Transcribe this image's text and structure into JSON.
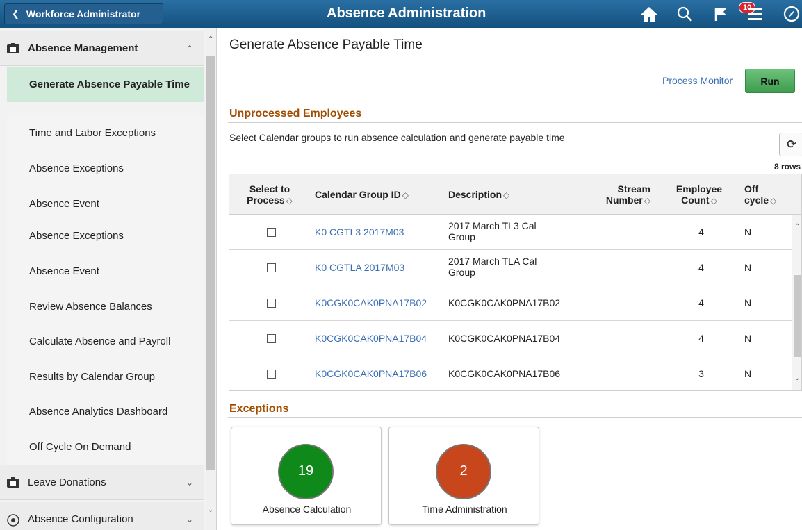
{
  "header": {
    "back_label": "Workforce Administrator",
    "title": "Absence Administration",
    "notification_count": "10",
    "icons": [
      "home-icon",
      "search-icon",
      "flag-icon",
      "menu-icon",
      "compass-icon"
    ]
  },
  "sidebar": {
    "groups": [
      {
        "label": "Absence Management",
        "icon": "folder-icon",
        "expanded": true
      },
      {
        "label": "Leave Donations",
        "icon": "folder-icon",
        "expanded": false
      },
      {
        "label": "Absence Configuration",
        "icon": "gear-icon",
        "expanded": false
      }
    ],
    "items": [
      {
        "label": "Generate Absence Payable Time",
        "active": true
      },
      {
        "label": "Time and Labor Exceptions"
      },
      {
        "label": "Absence Exceptions"
      },
      {
        "label": "Absence Event"
      },
      {
        "label": "Absence Exceptions"
      },
      {
        "label": "Absence Event"
      },
      {
        "label": "Review Absence Balances"
      },
      {
        "label": "Calculate Absence and Payroll"
      },
      {
        "label": "Results by Calendar Group"
      },
      {
        "label": "Absence Analytics Dashboard"
      },
      {
        "label": "Off Cycle On Demand"
      }
    ]
  },
  "main": {
    "page_title": "Generate Absence Payable Time",
    "process_monitor_label": "Process Monitor",
    "run_label": "Run",
    "unprocessed_title": "Unprocessed Employees",
    "instructions": "Select Calendar groups to run absence calculation and generate payable time",
    "row_count": "8 rows",
    "columns": {
      "select_1": "Select to",
      "select_2": "Process",
      "calendar_group": "Calendar Group ID",
      "description": "Description",
      "stream_1": "Stream",
      "stream_2": "Number",
      "emp_1": "Employee",
      "emp_2": "Count",
      "off_1": "Off",
      "off_2": "cycle"
    },
    "rows": [
      {
        "calendar_group": "K0 CGTL3 2017M03",
        "desc_1": "2017 March TL3 Cal",
        "desc_2": "Group",
        "stream": "",
        "count": "4",
        "off_cycle": "N"
      },
      {
        "calendar_group": "K0 CGTLA 2017M03",
        "desc_1": "2017 March TLA Cal",
        "desc_2": "Group",
        "stream": "",
        "count": "4",
        "off_cycle": "N"
      },
      {
        "calendar_group": "K0CGK0CAK0PNA17B02",
        "desc_1": "K0CGK0CAK0PNA17B02",
        "desc_2": "",
        "stream": "",
        "count": "4",
        "off_cycle": "N"
      },
      {
        "calendar_group": "K0CGK0CAK0PNA17B04",
        "desc_1": "K0CGK0CAK0PNA17B04",
        "desc_2": "",
        "stream": "",
        "count": "4",
        "off_cycle": "N"
      },
      {
        "calendar_group": "K0CGK0CAK0PNA17B06",
        "desc_1": "K0CGK0CAK0PNA17B06",
        "desc_2": "",
        "stream": "",
        "count": "3",
        "off_cycle": "N"
      }
    ],
    "exceptions_title": "Exceptions",
    "tiles": [
      {
        "value": "19",
        "label": "Absence Calculation",
        "color": "#0f8a1a"
      },
      {
        "value": "2",
        "label": "Time Administration",
        "color": "#c8461c"
      }
    ]
  },
  "colors": {
    "header_bg": "#1c5c8a",
    "active_item_bg": "#cfead9",
    "section_title": "#a14d00",
    "link": "#3a6eb5",
    "run_button": "#4cae5b"
  }
}
